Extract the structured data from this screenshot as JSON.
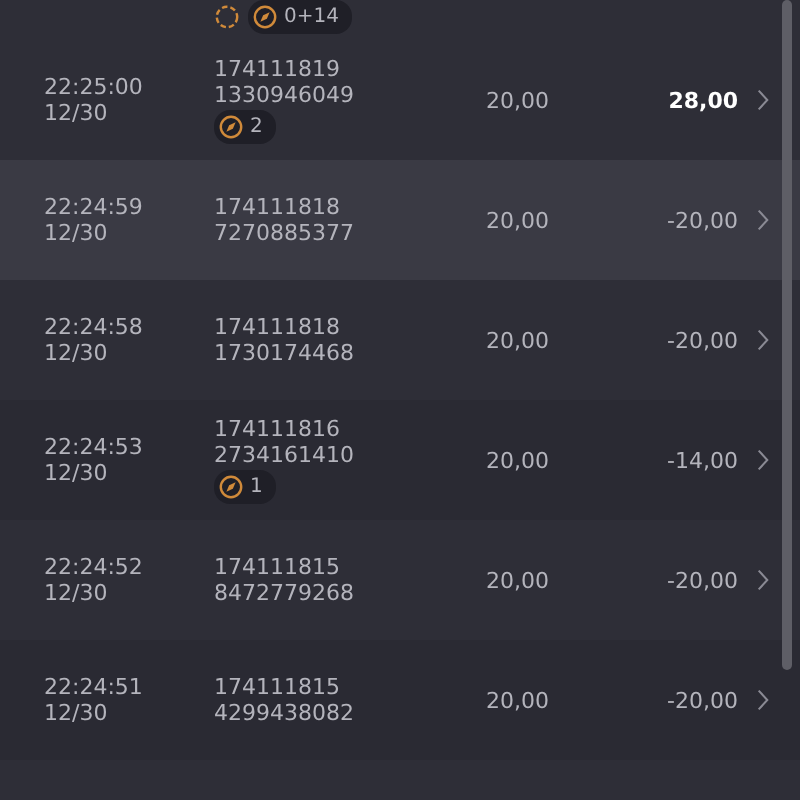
{
  "top_row": {
    "badges": [
      {
        "kind": "spinner"
      },
      {
        "kind": "compass",
        "count": "0+14"
      }
    ]
  },
  "rows": [
    {
      "time": "22:25:00",
      "date": "12/30",
      "round": "174111819",
      "id": "1330946049",
      "stake": "20,00",
      "result": "28,00",
      "win": true,
      "highlighted": false,
      "badge": {
        "count": "2"
      }
    },
    {
      "time": "22:24:59",
      "date": "12/30",
      "round": "174111818",
      "id": "7270885377",
      "stake": "20,00",
      "result": "-20,00",
      "win": false,
      "highlighted": true
    },
    {
      "time": "22:24:58",
      "date": "12/30",
      "round": "174111818",
      "id": "1730174468",
      "stake": "20,00",
      "result": "-20,00",
      "win": false,
      "highlighted": false
    },
    {
      "time": "22:24:53",
      "date": "12/30",
      "round": "174111816",
      "id": "2734161410",
      "stake": "20,00",
      "result": "-14,00",
      "win": false,
      "highlighted": false,
      "badge": {
        "count": "1"
      }
    },
    {
      "time": "22:24:52",
      "date": "12/30",
      "round": "174111815",
      "id": "8472779268",
      "stake": "20,00",
      "result": "-20,00",
      "win": false,
      "highlighted": false
    },
    {
      "time": "22:24:51",
      "date": "12/30",
      "round": "174111815",
      "id": "4299438082",
      "stake": "20,00",
      "result": "-20,00",
      "win": false,
      "highlighted": false
    }
  ]
}
